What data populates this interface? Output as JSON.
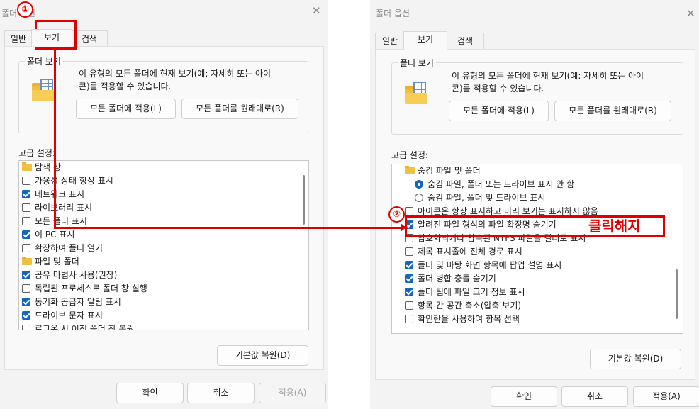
{
  "left_dialog": {
    "title": "폴더 옵션",
    "close": "✕",
    "tabs": [
      "일반",
      "보기",
      "검색"
    ],
    "folder_views_group": "폴더 보기",
    "folder_views_desc_1": "이 유형의 모든 폴더에 현재 보기(예: 자세히 또는 아이",
    "folder_views_desc_2": "콘)를 적용할 수 있습니다.",
    "apply_to_folders": "모든 폴더에 적용(L)",
    "reset_folders": "모든 폴더를 원래대로(R)",
    "advanced_label": "고급 설정:",
    "list": [
      {
        "kind": "folder",
        "label": "탐색 창"
      },
      {
        "kind": "check",
        "checked": false,
        "label": "가용성 상태 항상 표시"
      },
      {
        "kind": "check",
        "checked": true,
        "label": "네트워크 표시"
      },
      {
        "kind": "check",
        "checked": false,
        "label": "라이브러리 표시"
      },
      {
        "kind": "check",
        "checked": false,
        "label": "모든 폴더 표시"
      },
      {
        "kind": "check",
        "checked": true,
        "label": "이 PC 표시"
      },
      {
        "kind": "check",
        "checked": false,
        "label": "확장하여 폴더 열기"
      },
      {
        "kind": "folder",
        "label": "파일 및 폴더"
      },
      {
        "kind": "check",
        "checked": true,
        "label": "공유 마법사 사용(권장)"
      },
      {
        "kind": "check",
        "checked": false,
        "label": "독립된 프로세스로 폴더 창 실행"
      },
      {
        "kind": "check",
        "checked": true,
        "label": "동기화 공급자 알림 표시"
      },
      {
        "kind": "check",
        "checked": true,
        "label": "드라이브 문자 표시"
      },
      {
        "kind": "check",
        "checked": false,
        "label": "로그온 시 이전 폴더 창 복원"
      }
    ],
    "restore_defaults": "기본값 복원(D)",
    "ok": "확인",
    "cancel": "취소",
    "apply": "적용(A)"
  },
  "right_dialog": {
    "title": "폴더 옵션",
    "close": "✕",
    "tabs": [
      "일반",
      "보기",
      "검색"
    ],
    "folder_views_group": "폴더 보기",
    "folder_views_desc_1": "이 유형의 모든 폴더에 현재 보기(예: 자세히 또는 아이",
    "folder_views_desc_2": "콘)를 적용할 수 있습니다.",
    "apply_to_folders": "모든 폴더에 적용(L)",
    "reset_folders": "모든 폴더를 원래대로(R)",
    "advanced_label": "고급 설정:",
    "list": [
      {
        "kind": "folder",
        "label": "숨김 파일 및 폴더",
        "indent": 1
      },
      {
        "kind": "radio",
        "checked": true,
        "label": "숨김 파일, 폴더 또는 드라이브 표시 안 함",
        "indent": 2
      },
      {
        "kind": "radio",
        "checked": false,
        "label": "숨김 파일, 폴더 및 드라이브 표시",
        "indent": 2
      },
      {
        "kind": "check",
        "checked": false,
        "label": "아이콘은 항상 표시하고 미리 보기는 표시하지 않음",
        "indent": 1
      },
      {
        "kind": "check",
        "checked": true,
        "label": "알려진 파일 형식의 파일 확장명 숨기기",
        "indent": 1
      },
      {
        "kind": "check",
        "checked": false,
        "label": "암호화되거나 압축된 NTFS 파일을 컬러로 표시",
        "indent": 1
      },
      {
        "kind": "check",
        "checked": false,
        "label": "제목 표시줄에 전체 경로 표시",
        "indent": 1
      },
      {
        "kind": "check",
        "checked": true,
        "label": "폴더 및 바탕 화면 항목에 팝업 설명 표시",
        "indent": 1
      },
      {
        "kind": "check",
        "checked": true,
        "label": "폴더 병합 충돌 숨기기",
        "indent": 1
      },
      {
        "kind": "check",
        "checked": true,
        "label": "폴더 팁에 파일 크기 정보 표시",
        "indent": 1
      },
      {
        "kind": "check",
        "checked": false,
        "label": "항목 간 공간 축소(압축 보기)",
        "indent": 1
      },
      {
        "kind": "check",
        "checked": false,
        "label": "확인란을 사용하여 항목 선택",
        "indent": 1
      }
    ],
    "restore_defaults": "기본값 복원(D)",
    "ok": "확인",
    "cancel": "취소",
    "apply": "적용(A)"
  },
  "annotations": {
    "step1": "①",
    "step2": "②",
    "uncheck_text": "클릭해지",
    "color": "#e00000"
  }
}
